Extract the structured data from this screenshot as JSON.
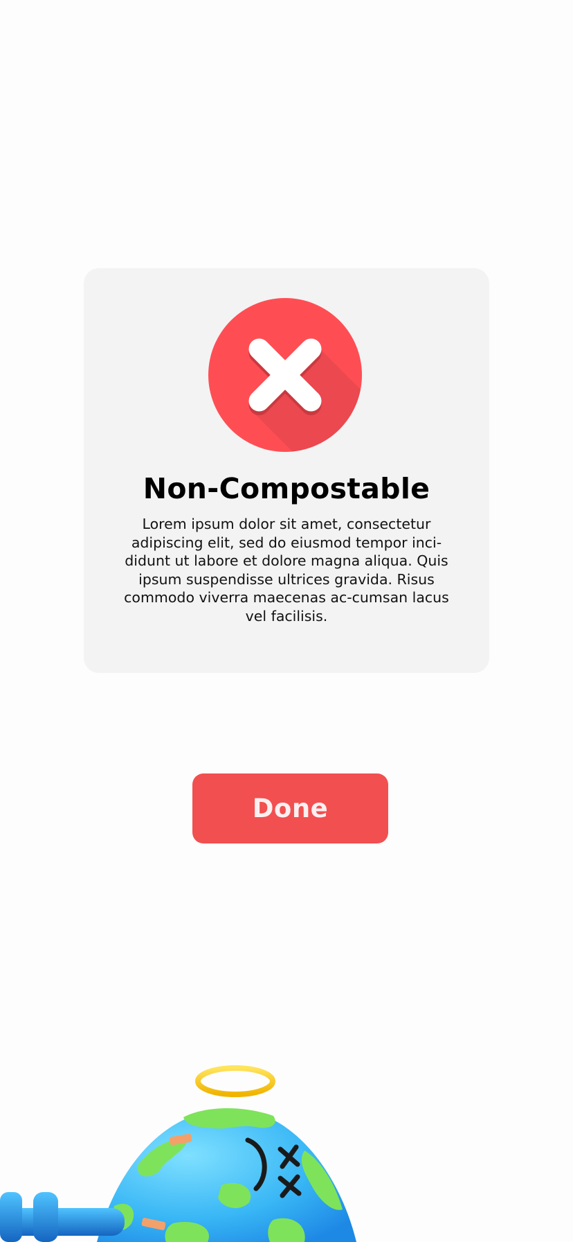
{
  "result_card": {
    "icon": "close-x-icon",
    "title": "Non-Compostable",
    "description": "Lorem ipsum dolor sit amet, consectetur adipiscing elit, sed do eiusmod tempor inci-didunt ut labore et dolore magna aliqua. Quis ipsum suspendisse ultrices gravida. Risus commodo viverra maecenas ac-cumsan lacus vel facilisis."
  },
  "actions": {
    "done_label": "Done"
  },
  "illustration": {
    "icon": "dead-earth-with-halo-illustration"
  },
  "colors": {
    "accent_red": "#f24f50",
    "icon_red": "#fe4e54",
    "card_background": "#f3f3f3",
    "page_background": "#fdfdfd"
  }
}
